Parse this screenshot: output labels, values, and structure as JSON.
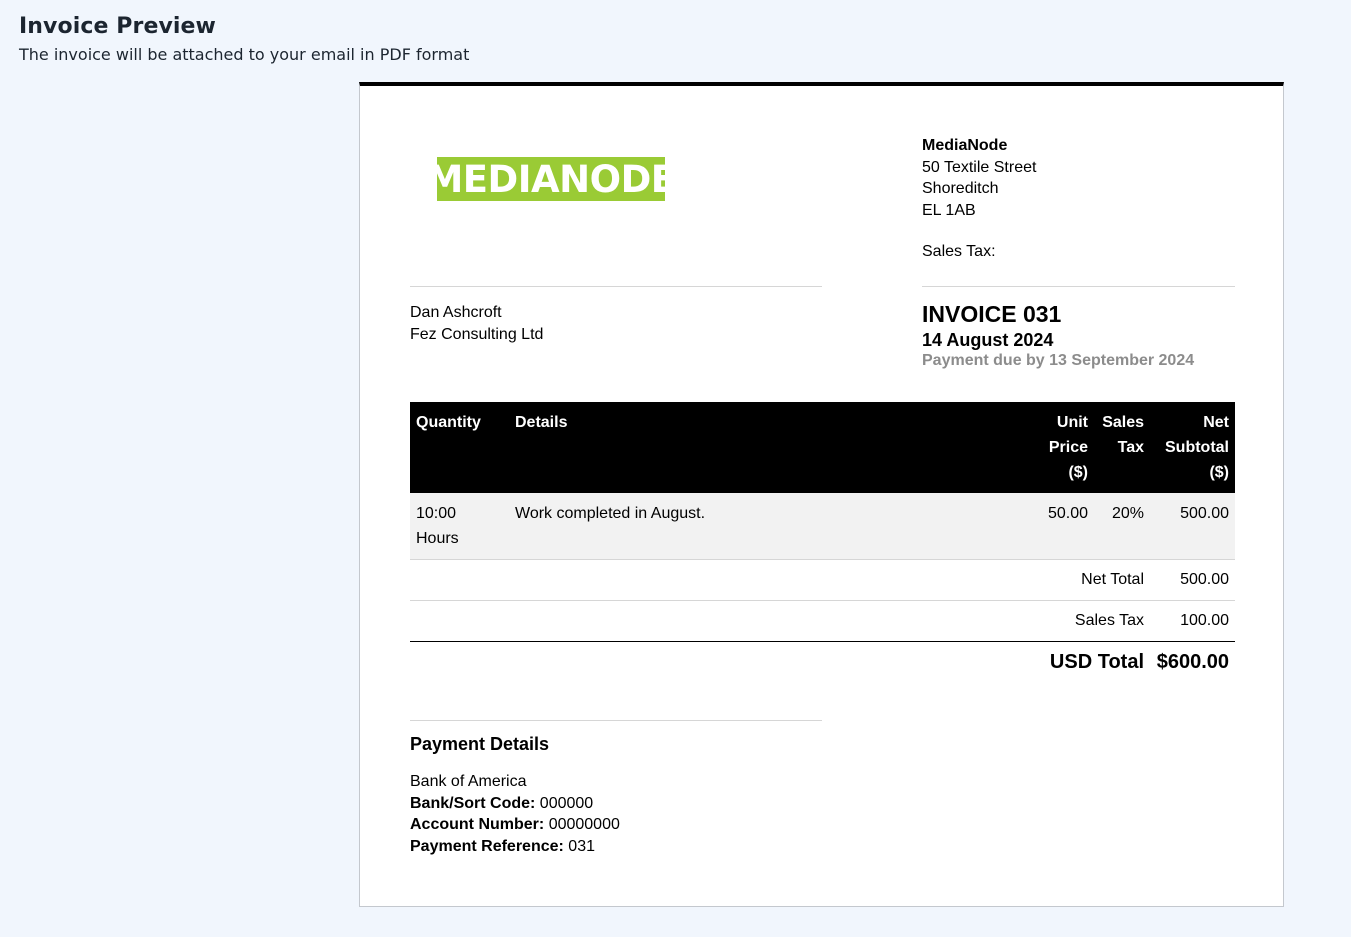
{
  "page": {
    "title": "Invoice Preview",
    "subtitle": "The invoice will be attached to your email in PDF format"
  },
  "invoice": {
    "logo_text": "MEDIANODE",
    "company": {
      "name": "MediaNode",
      "address": [
        "50 Textile Street",
        "Shoreditch",
        "EL 1AB"
      ],
      "sales_tax_label": "Sales Tax:"
    },
    "client": {
      "name": "Dan Ashcroft",
      "company": "Fez Consulting Ltd"
    },
    "number": "INVOICE 031",
    "date": "14 August 2024",
    "due": "Payment due by 13 September 2024",
    "table": {
      "headers": {
        "quantity": "Quantity",
        "details": "Details",
        "unit_price": [
          "Unit",
          "Price",
          "($)"
        ],
        "sales_tax": [
          "Sales",
          "Tax"
        ],
        "net_subtotal": [
          "Net",
          "Subtotal",
          "($)"
        ]
      },
      "rows": [
        {
          "quantity": [
            "10:00",
            "Hours"
          ],
          "details": "Work completed in August.",
          "unit_price": "50.00",
          "sales_tax": "20%",
          "net_subtotal": "500.00"
        }
      ]
    },
    "summary": {
      "net_total_label": "Net Total",
      "net_total": "500.00",
      "sales_tax_label": "Sales Tax",
      "sales_tax": "100.00",
      "total_label": "USD Total",
      "total": "$600.00"
    },
    "payment": {
      "heading": "Payment Details",
      "bank": "Bank of America",
      "sort_code_label": "Bank/Sort Code:",
      "sort_code": "000000",
      "account_label": "Account Number:",
      "account": "00000000",
      "reference_label": "Payment Reference:",
      "reference": "031"
    }
  }
}
